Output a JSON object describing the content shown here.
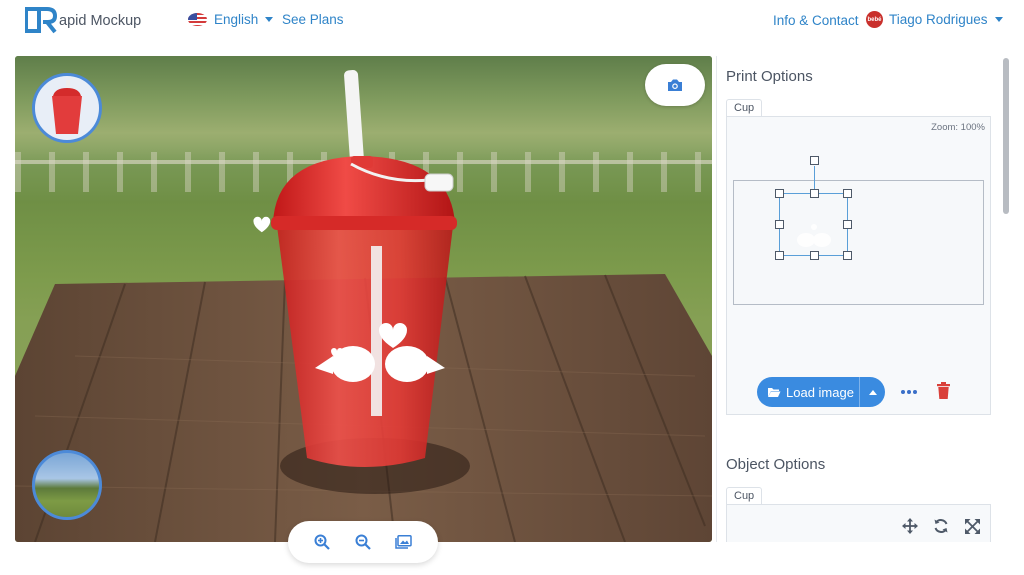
{
  "app": {
    "logo_text": "apid Mockup",
    "language": "English",
    "see_plans": "See Plans",
    "info_contact": "Info & Contact",
    "user_name": "Tiago Rodrigues",
    "user_avatar_text": "bebé"
  },
  "print_options": {
    "title": "Print Options",
    "tab": "Cup",
    "zoom_label": "Zoom: 100%",
    "load_button": "Load image"
  },
  "object_options": {
    "title": "Object Options",
    "tab": "Cup"
  },
  "colors": {
    "accent": "#3a8be0",
    "link": "#2f84c8",
    "delete": "#d9403a",
    "cup_red": "#e13b3b"
  },
  "icons": [
    "camera-icon",
    "zoom-in-icon",
    "zoom-out-icon",
    "image-icon",
    "folder-open-icon",
    "more-horizontal-icon",
    "trash-icon",
    "move-icon",
    "rotate-icon",
    "scale-icon"
  ]
}
